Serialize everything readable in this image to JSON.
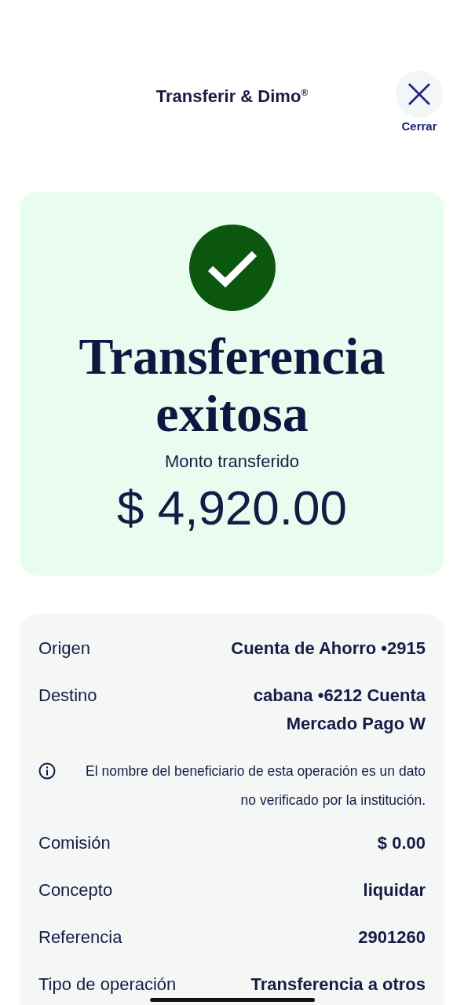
{
  "header": {
    "title": "Transferir & Dimo$^{®}$",
    "close_label": "Cerrar"
  },
  "result": {
    "title": "Transferencia exitosa",
    "amount_label": "Monto transferido",
    "amount": "$ 4,920.00"
  },
  "details": [
    {
      "kind": "row",
      "label": "Origen",
      "value": "Cuenta de Ahorro •2915"
    },
    {
      "kind": "row",
      "label": "Destino",
      "value": "cabana •6212 Cuenta Mercado Pago W"
    },
    {
      "kind": "note",
      "text": "El nombre del beneficiario de esta operación es un dato no verificado por la institución."
    },
    {
      "kind": "row",
      "label": "Comisión",
      "value": "$ 0.00"
    },
    {
      "kind": "row",
      "label": "Concepto",
      "value": "liquidar"
    },
    {
      "kind": "row",
      "label": "Referencia",
      "value": "2901260"
    },
    {
      "kind": "row",
      "label": "Tipo de operación",
      "value": "Transferencia a otros"
    }
  ]
}
